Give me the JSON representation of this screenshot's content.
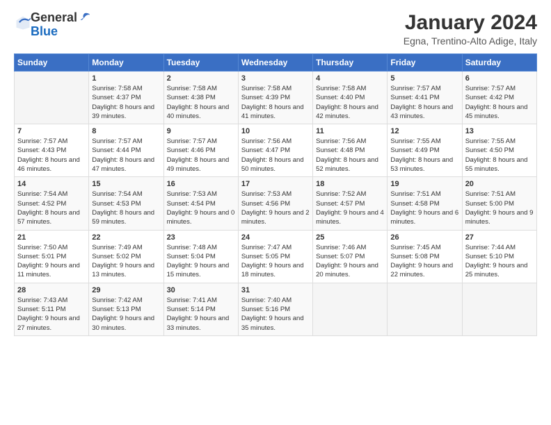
{
  "header": {
    "logo_general": "General",
    "logo_blue": "Blue",
    "month_title": "January 2024",
    "location": "Egna, Trentino-Alto Adige, Italy"
  },
  "weekdays": [
    "Sunday",
    "Monday",
    "Tuesday",
    "Wednesday",
    "Thursday",
    "Friday",
    "Saturday"
  ],
  "weeks": [
    [
      {
        "day": "",
        "sunrise": "",
        "sunset": "",
        "daylight": ""
      },
      {
        "day": "1",
        "sunrise": "Sunrise: 7:58 AM",
        "sunset": "Sunset: 4:37 PM",
        "daylight": "Daylight: 8 hours and 39 minutes."
      },
      {
        "day": "2",
        "sunrise": "Sunrise: 7:58 AM",
        "sunset": "Sunset: 4:38 PM",
        "daylight": "Daylight: 8 hours and 40 minutes."
      },
      {
        "day": "3",
        "sunrise": "Sunrise: 7:58 AM",
        "sunset": "Sunset: 4:39 PM",
        "daylight": "Daylight: 8 hours and 41 minutes."
      },
      {
        "day": "4",
        "sunrise": "Sunrise: 7:58 AM",
        "sunset": "Sunset: 4:40 PM",
        "daylight": "Daylight: 8 hours and 42 minutes."
      },
      {
        "day": "5",
        "sunrise": "Sunrise: 7:57 AM",
        "sunset": "Sunset: 4:41 PM",
        "daylight": "Daylight: 8 hours and 43 minutes."
      },
      {
        "day": "6",
        "sunrise": "Sunrise: 7:57 AM",
        "sunset": "Sunset: 4:42 PM",
        "daylight": "Daylight: 8 hours and 45 minutes."
      }
    ],
    [
      {
        "day": "7",
        "sunrise": "Sunrise: 7:57 AM",
        "sunset": "Sunset: 4:43 PM",
        "daylight": "Daylight: 8 hours and 46 minutes."
      },
      {
        "day": "8",
        "sunrise": "Sunrise: 7:57 AM",
        "sunset": "Sunset: 4:44 PM",
        "daylight": "Daylight: 8 hours and 47 minutes."
      },
      {
        "day": "9",
        "sunrise": "Sunrise: 7:57 AM",
        "sunset": "Sunset: 4:46 PM",
        "daylight": "Daylight: 8 hours and 49 minutes."
      },
      {
        "day": "10",
        "sunrise": "Sunrise: 7:56 AM",
        "sunset": "Sunset: 4:47 PM",
        "daylight": "Daylight: 8 hours and 50 minutes."
      },
      {
        "day": "11",
        "sunrise": "Sunrise: 7:56 AM",
        "sunset": "Sunset: 4:48 PM",
        "daylight": "Daylight: 8 hours and 52 minutes."
      },
      {
        "day": "12",
        "sunrise": "Sunrise: 7:55 AM",
        "sunset": "Sunset: 4:49 PM",
        "daylight": "Daylight: 8 hours and 53 minutes."
      },
      {
        "day": "13",
        "sunrise": "Sunrise: 7:55 AM",
        "sunset": "Sunset: 4:50 PM",
        "daylight": "Daylight: 8 hours and 55 minutes."
      }
    ],
    [
      {
        "day": "14",
        "sunrise": "Sunrise: 7:54 AM",
        "sunset": "Sunset: 4:52 PM",
        "daylight": "Daylight: 8 hours and 57 minutes."
      },
      {
        "day": "15",
        "sunrise": "Sunrise: 7:54 AM",
        "sunset": "Sunset: 4:53 PM",
        "daylight": "Daylight: 8 hours and 59 minutes."
      },
      {
        "day": "16",
        "sunrise": "Sunrise: 7:53 AM",
        "sunset": "Sunset: 4:54 PM",
        "daylight": "Daylight: 9 hours and 0 minutes."
      },
      {
        "day": "17",
        "sunrise": "Sunrise: 7:53 AM",
        "sunset": "Sunset: 4:56 PM",
        "daylight": "Daylight: 9 hours and 2 minutes."
      },
      {
        "day": "18",
        "sunrise": "Sunrise: 7:52 AM",
        "sunset": "Sunset: 4:57 PM",
        "daylight": "Daylight: 9 hours and 4 minutes."
      },
      {
        "day": "19",
        "sunrise": "Sunrise: 7:51 AM",
        "sunset": "Sunset: 4:58 PM",
        "daylight": "Daylight: 9 hours and 6 minutes."
      },
      {
        "day": "20",
        "sunrise": "Sunrise: 7:51 AM",
        "sunset": "Sunset: 5:00 PM",
        "daylight": "Daylight: 9 hours and 9 minutes."
      }
    ],
    [
      {
        "day": "21",
        "sunrise": "Sunrise: 7:50 AM",
        "sunset": "Sunset: 5:01 PM",
        "daylight": "Daylight: 9 hours and 11 minutes."
      },
      {
        "day": "22",
        "sunrise": "Sunrise: 7:49 AM",
        "sunset": "Sunset: 5:02 PM",
        "daylight": "Daylight: 9 hours and 13 minutes."
      },
      {
        "day": "23",
        "sunrise": "Sunrise: 7:48 AM",
        "sunset": "Sunset: 5:04 PM",
        "daylight": "Daylight: 9 hours and 15 minutes."
      },
      {
        "day": "24",
        "sunrise": "Sunrise: 7:47 AM",
        "sunset": "Sunset: 5:05 PM",
        "daylight": "Daylight: 9 hours and 18 minutes."
      },
      {
        "day": "25",
        "sunrise": "Sunrise: 7:46 AM",
        "sunset": "Sunset: 5:07 PM",
        "daylight": "Daylight: 9 hours and 20 minutes."
      },
      {
        "day": "26",
        "sunrise": "Sunrise: 7:45 AM",
        "sunset": "Sunset: 5:08 PM",
        "daylight": "Daylight: 9 hours and 22 minutes."
      },
      {
        "day": "27",
        "sunrise": "Sunrise: 7:44 AM",
        "sunset": "Sunset: 5:10 PM",
        "daylight": "Daylight: 9 hours and 25 minutes."
      }
    ],
    [
      {
        "day": "28",
        "sunrise": "Sunrise: 7:43 AM",
        "sunset": "Sunset: 5:11 PM",
        "daylight": "Daylight: 9 hours and 27 minutes."
      },
      {
        "day": "29",
        "sunrise": "Sunrise: 7:42 AM",
        "sunset": "Sunset: 5:13 PM",
        "daylight": "Daylight: 9 hours and 30 minutes."
      },
      {
        "day": "30",
        "sunrise": "Sunrise: 7:41 AM",
        "sunset": "Sunset: 5:14 PM",
        "daylight": "Daylight: 9 hours and 33 minutes."
      },
      {
        "day": "31",
        "sunrise": "Sunrise: 7:40 AM",
        "sunset": "Sunset: 5:16 PM",
        "daylight": "Daylight: 9 hours and 35 minutes."
      },
      {
        "day": "",
        "sunrise": "",
        "sunset": "",
        "daylight": ""
      },
      {
        "day": "",
        "sunrise": "",
        "sunset": "",
        "daylight": ""
      },
      {
        "day": "",
        "sunrise": "",
        "sunset": "",
        "daylight": ""
      }
    ]
  ]
}
